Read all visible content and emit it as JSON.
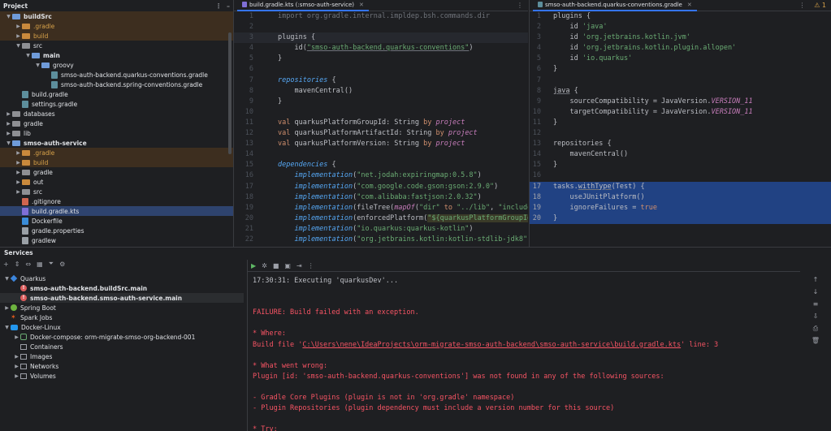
{
  "project": {
    "title": "Project",
    "items": [
      {
        "label": "buildSrc",
        "level": 0,
        "expanded": true,
        "kind": "folder-blue",
        "bold": true,
        "bg": "ex"
      },
      {
        "label": ".gradle",
        "level": 1,
        "expanded": false,
        "kind": "folder-orange",
        "orange": true,
        "bg": "ex"
      },
      {
        "label": "build",
        "level": 1,
        "expanded": false,
        "kind": "folder-orange",
        "orange": true,
        "bg": "ex"
      },
      {
        "label": "src",
        "level": 1,
        "expanded": true,
        "kind": "folder"
      },
      {
        "label": "main",
        "level": 2,
        "expanded": true,
        "kind": "folder-blue",
        "bold": true
      },
      {
        "label": "groovy",
        "level": 3,
        "expanded": true,
        "kind": "folder-blue"
      },
      {
        "label": "smso-auth-backend.quarkus-conventions.gradle",
        "level": 4,
        "kind": "gradle"
      },
      {
        "label": "smso-auth-backend.spring-conventions.gradle",
        "level": 4,
        "kind": "gradle"
      },
      {
        "label": "build.gradle",
        "level": 1,
        "kind": "gradle"
      },
      {
        "label": "settings.gradle",
        "level": 1,
        "kind": "gradle"
      },
      {
        "label": "databases",
        "level": 0,
        "expanded": false,
        "kind": "folder"
      },
      {
        "label": "gradle",
        "level": 0,
        "expanded": false,
        "kind": "folder"
      },
      {
        "label": "lib",
        "level": 0,
        "expanded": false,
        "kind": "folder"
      },
      {
        "label": "smso-auth-service",
        "level": 0,
        "expanded": true,
        "kind": "folder-blue",
        "bold": true
      },
      {
        "label": ".gradle",
        "level": 1,
        "expanded": false,
        "kind": "folder-orange",
        "orange": true,
        "bg": "ex"
      },
      {
        "label": "build",
        "level": 1,
        "expanded": false,
        "kind": "folder-orange",
        "orange": true,
        "bg": "ex"
      },
      {
        "label": "gradle",
        "level": 1,
        "expanded": false,
        "kind": "folder"
      },
      {
        "label": "out",
        "level": 1,
        "expanded": false,
        "kind": "folder-orange"
      },
      {
        "label": "src",
        "level": 1,
        "expanded": false,
        "kind": "folder"
      },
      {
        "label": ".gitignore",
        "level": 1,
        "kind": "git"
      },
      {
        "label": "build.gradle.kts",
        "level": 1,
        "kind": "kts",
        "bg": "sel"
      },
      {
        "label": "Dockerfile",
        "level": 1,
        "kind": "docker"
      },
      {
        "label": "gradle.properties",
        "level": 1,
        "kind": "props"
      },
      {
        "label": "gradlew",
        "level": 1,
        "kind": "props"
      }
    ]
  },
  "editor1": {
    "tab_label": "build.gradle.kts (:smso-auth-service)",
    "warning_text": "⚠ 1",
    "lines": [
      {
        "n": "1",
        "segs": [
          [
            "c-gr",
            "import org.gradle.internal.impldep.bsh.commands.dir"
          ]
        ]
      },
      {
        "n": "2",
        "segs": []
      },
      {
        "n": "3",
        "cur": true,
        "segs": [
          [
            "c-id",
            "plugins {"
          ]
        ]
      },
      {
        "n": "4",
        "segs": [
          [
            "c-id",
            "    id("
          ],
          [
            "c-str c-ul",
            "\"smso-auth-backend.quarkus-conventions\""
          ],
          [
            "c-id",
            ")"
          ]
        ]
      },
      {
        "n": "5",
        "segs": [
          [
            "c-id",
            "}"
          ]
        ]
      },
      {
        "n": "6",
        "segs": []
      },
      {
        "n": "7",
        "segs": [
          [
            "c-fn",
            "repositories"
          ],
          [
            "c-id",
            " {"
          ]
        ]
      },
      {
        "n": "8",
        "segs": [
          [
            "c-id",
            "    mavenCentral()"
          ]
        ]
      },
      {
        "n": "9",
        "segs": [
          [
            "c-id",
            "}"
          ]
        ]
      },
      {
        "n": "10",
        "segs": []
      },
      {
        "n": "11",
        "segs": [
          [
            "c-kw",
            "val "
          ],
          [
            "c-id",
            "quarkusPlatformGroupId: String "
          ],
          [
            "c-kw",
            "by "
          ],
          [
            "c-pur",
            "project"
          ]
        ]
      },
      {
        "n": "12",
        "segs": [
          [
            "c-kw",
            "val "
          ],
          [
            "c-id",
            "quarkusPlatformArtifactId: String "
          ],
          [
            "c-kw",
            "by "
          ],
          [
            "c-pur",
            "project"
          ]
        ]
      },
      {
        "n": "13",
        "segs": [
          [
            "c-kw",
            "val "
          ],
          [
            "c-id",
            "quarkusPlatformVersion: String "
          ],
          [
            "c-kw",
            "by "
          ],
          [
            "c-pur",
            "project"
          ]
        ]
      },
      {
        "n": "14",
        "segs": []
      },
      {
        "n": "15",
        "segs": [
          [
            "c-fn",
            "dependencies"
          ],
          [
            "c-id",
            " {"
          ]
        ]
      },
      {
        "n": "16",
        "segs": [
          [
            "c-fn",
            "    implementation"
          ],
          [
            "c-id",
            "("
          ],
          [
            "c-str",
            "\"net.jodah:expiringmap:0.5.8\""
          ],
          [
            "c-id",
            ")"
          ]
        ]
      },
      {
        "n": "17",
        "segs": [
          [
            "c-fn",
            "    implementation"
          ],
          [
            "c-id",
            "("
          ],
          [
            "c-str",
            "\"com.google.code.gson:gson:2.9.0\""
          ],
          [
            "c-id",
            ")"
          ]
        ]
      },
      {
        "n": "18",
        "segs": [
          [
            "c-fn",
            "    implementation"
          ],
          [
            "c-id",
            "("
          ],
          [
            "c-str",
            "\"com.alibaba:fastjson:2.0.32\""
          ],
          [
            "c-id",
            ")"
          ]
        ]
      },
      {
        "n": "19",
        "segs": [
          [
            "c-fn",
            "    implementation"
          ],
          [
            "c-id",
            "(fileTree("
          ],
          [
            "c-pur",
            "mapOf"
          ],
          [
            "c-id",
            "("
          ],
          [
            "c-str",
            "\"dir\""
          ],
          [
            "c-id",
            " "
          ],
          [
            "c-kw",
            "to"
          ],
          [
            "c-id",
            " "
          ],
          [
            "c-str",
            "\"../lib\""
          ],
          [
            "c-id",
            ", "
          ],
          [
            "c-str",
            "\"include\""
          ],
          [
            "c-id",
            " "
          ],
          [
            "c-kw",
            "to"
          ],
          [
            "c-id",
            " l"
          ]
        ]
      },
      {
        "n": "20",
        "segs": [
          [
            "c-fn",
            "    implementation"
          ],
          [
            "c-id",
            "(enforcedPlatform("
          ],
          [
            "c-str c-bg",
            "\"${quarkusPlatformGroupId}:${qu"
          ]
        ]
      },
      {
        "n": "21",
        "segs": [
          [
            "c-fn",
            "    implementation"
          ],
          [
            "c-id",
            "("
          ],
          [
            "c-str",
            "\"io.quarkus:quarkus-kotlin\""
          ],
          [
            "c-id",
            ")"
          ]
        ]
      },
      {
        "n": "22",
        "segs": [
          [
            "c-fn",
            "    implementation"
          ],
          [
            "c-id",
            "("
          ],
          [
            "c-str",
            "\"org.jetbrains.kotlin:kotlin-stdlib-jdk8\""
          ],
          [
            "c-id",
            ")"
          ]
        ]
      }
    ]
  },
  "editor2": {
    "tab_label": "smso-auth-backend.quarkus-conventions.gradle",
    "lines": [
      {
        "n": "1",
        "segs": [
          [
            "c-id",
            "plugins {"
          ]
        ]
      },
      {
        "n": "2",
        "segs": [
          [
            "c-id",
            "    id "
          ],
          [
            "c-str",
            "'java'"
          ]
        ]
      },
      {
        "n": "3",
        "segs": [
          [
            "c-id",
            "    id "
          ],
          [
            "c-str",
            "'org.jetbrains.kotlin.jvm'"
          ]
        ]
      },
      {
        "n": "4",
        "segs": [
          [
            "c-id",
            "    id "
          ],
          [
            "c-str",
            "'org.jetbrains.kotlin.plugin.allopen'"
          ]
        ]
      },
      {
        "n": "5",
        "segs": [
          [
            "c-id",
            "    id "
          ],
          [
            "c-str",
            "'io.quarkus'"
          ]
        ]
      },
      {
        "n": "6",
        "segs": [
          [
            "c-id",
            "}"
          ]
        ]
      },
      {
        "n": "7",
        "segs": []
      },
      {
        "n": "8",
        "segs": [
          [
            "c-id c-ul",
            "java"
          ],
          [
            "c-id",
            " {"
          ]
        ]
      },
      {
        "n": "9",
        "segs": [
          [
            "c-id",
            "    sourceCompatibility = JavaVersion."
          ],
          [
            "c-pur",
            "VERSION_11"
          ]
        ]
      },
      {
        "n": "10",
        "segs": [
          [
            "c-id",
            "    targetCompatibility = JavaVersion."
          ],
          [
            "c-pur",
            "VERSION_11"
          ]
        ]
      },
      {
        "n": "11",
        "segs": [
          [
            "c-id",
            "}"
          ]
        ]
      },
      {
        "n": "12",
        "segs": []
      },
      {
        "n": "13",
        "segs": [
          [
            "c-id",
            "repositories {"
          ]
        ]
      },
      {
        "n": "14",
        "segs": [
          [
            "c-id",
            "    mavenCentral()"
          ]
        ]
      },
      {
        "n": "15",
        "segs": [
          [
            "c-id",
            "}"
          ]
        ]
      },
      {
        "n": "16",
        "segs": []
      },
      {
        "n": "17",
        "hl": true,
        "segs": [
          [
            "c-id",
            "tasks."
          ],
          [
            "c-id c-ul",
            "withType"
          ],
          [
            "c-id",
            "(Test) {"
          ]
        ]
      },
      {
        "n": "18",
        "hl": true,
        "segs": [
          [
            "c-id",
            "    useJUnitPlatform()"
          ]
        ]
      },
      {
        "n": "19",
        "hl": true,
        "segs": [
          [
            "c-id",
            "    ignoreFailures = "
          ],
          [
            "c-kw",
            "true"
          ]
        ]
      },
      {
        "n": "20",
        "hl": true,
        "segs": [
          [
            "c-id",
            "}"
          ]
        ]
      }
    ]
  },
  "services": {
    "title": "Services",
    "tree": [
      {
        "label": "Quarkus",
        "level": 0,
        "expanded": true,
        "icon": "quark"
      },
      {
        "label": "smso-auth-backend.buildSrc.main",
        "level": 1,
        "icon": "err",
        "bold": true
      },
      {
        "label": "smso-auth-backend.smso-auth-service.main",
        "level": 1,
        "icon": "err",
        "bold": true,
        "bg": "hov"
      },
      {
        "label": "Spring Boot",
        "level": 0,
        "expanded": false,
        "icon": "spring"
      },
      {
        "label": "Spark Jobs",
        "level": 0,
        "icon": "spark"
      },
      {
        "label": "Docker-Linux",
        "level": 0,
        "expanded": true,
        "icon": "docker"
      },
      {
        "label": "Docker-compose: orm-migrate-smso-org-backend-001",
        "level": 1,
        "expanded": false,
        "icon": "compose"
      },
      {
        "label": "Containers",
        "level": 1,
        "icon": "sq"
      },
      {
        "label": "Images",
        "level": 1,
        "expanded": false,
        "icon": "sq"
      },
      {
        "label": "Networks",
        "level": 1,
        "expanded": false,
        "icon": "sq"
      },
      {
        "label": "Volumes",
        "level": 1,
        "expanded": false,
        "icon": "sq"
      }
    ],
    "console": [
      {
        "cls": "norm",
        "text": "17:30:31: Executing 'quarkusDev'..."
      },
      {
        "cls": "norm",
        "text": ""
      },
      {
        "cls": "norm",
        "text": ""
      },
      {
        "cls": "err",
        "text": "FAILURE: Build failed with an exception."
      },
      {
        "cls": "norm",
        "text": ""
      },
      {
        "cls": "err",
        "text": "* Where:"
      },
      {
        "cls": "err",
        "text": "Build file '",
        "link": "C:\\Users\\nene\\IdeaProjects\\orm-migrate-smso-auth-backend\\smso-auth-service\\build.gradle.kts",
        "after": "' line: 3"
      },
      {
        "cls": "norm",
        "text": ""
      },
      {
        "cls": "err",
        "text": "* What went wrong:"
      },
      {
        "cls": "err",
        "text": "Plugin [id: 'smso-auth-backend.quarkus-conventions'] was not found in any of the following sources:"
      },
      {
        "cls": "norm",
        "text": ""
      },
      {
        "cls": "err",
        "text": "- Gradle Core Plugins (plugin is not in 'org.gradle' namespace)"
      },
      {
        "cls": "err",
        "text": "- Plugin Repositories (plugin dependency must include a version number for this source)"
      },
      {
        "cls": "norm",
        "text": ""
      },
      {
        "cls": "err",
        "text": "* Try:"
      }
    ]
  }
}
